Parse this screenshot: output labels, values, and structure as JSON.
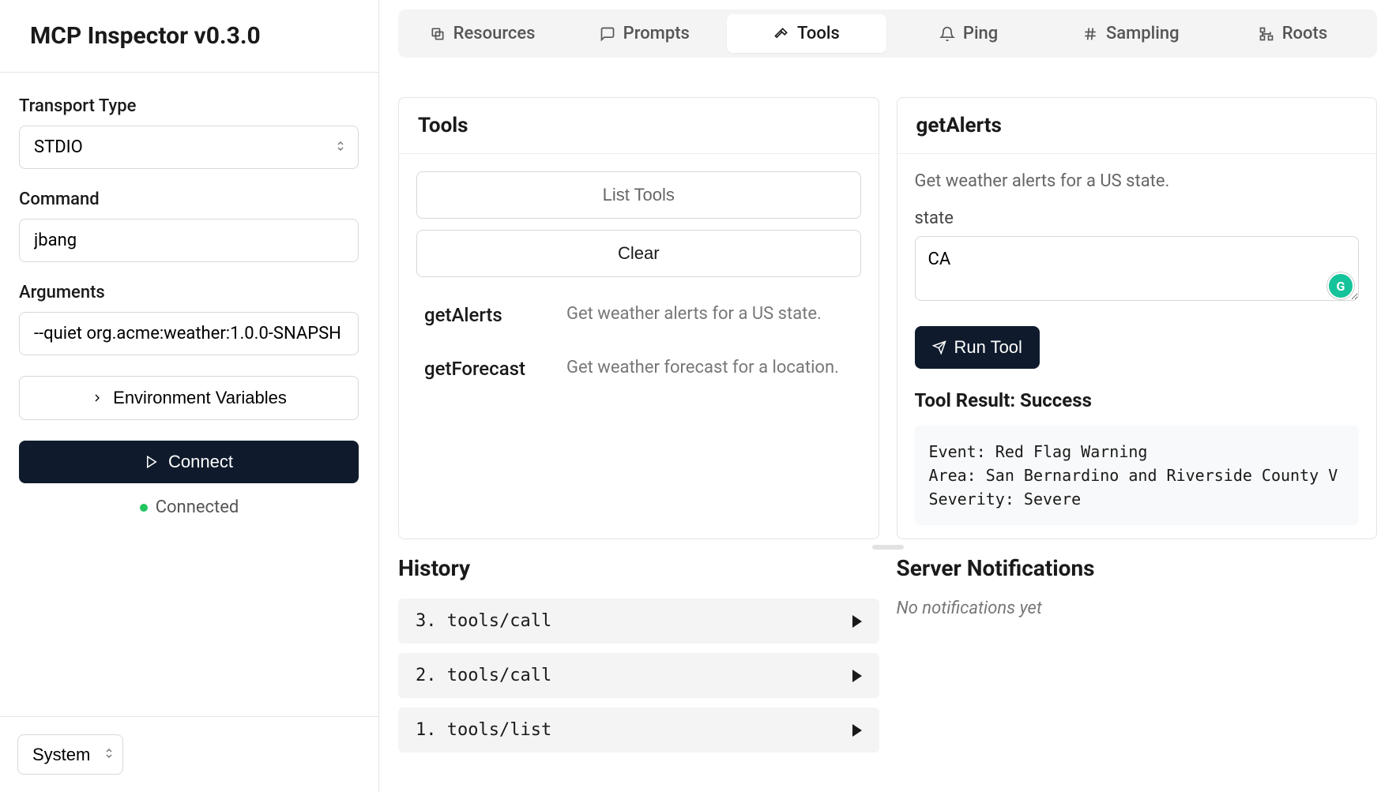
{
  "header": {
    "title": "MCP Inspector v0.3.0"
  },
  "sidebar": {
    "transport_label": "Transport Type",
    "transport_value": "STDIO",
    "command_label": "Command",
    "command_value": "jbang",
    "arguments_label": "Arguments",
    "arguments_value": "--quiet org.acme:weather:1.0.0-SNAPSH",
    "env_label": "Environment Variables",
    "connect_label": "Connect",
    "status_label": "Connected",
    "theme_value": "System"
  },
  "tabs": [
    {
      "label": "Resources",
      "icon": "copy"
    },
    {
      "label": "Prompts",
      "icon": "message"
    },
    {
      "label": "Tools",
      "icon": "hammer",
      "active": true
    },
    {
      "label": "Ping",
      "icon": "bell"
    },
    {
      "label": "Sampling",
      "icon": "hash"
    },
    {
      "label": "Roots",
      "icon": "tree"
    }
  ],
  "tools_panel": {
    "title": "Tools",
    "list_label": "List Tools",
    "clear_label": "Clear",
    "items": [
      {
        "name": "getAlerts",
        "desc": "Get weather alerts for a US state."
      },
      {
        "name": "getForecast",
        "desc": "Get weather forecast for a location."
      }
    ]
  },
  "detail_panel": {
    "title": "getAlerts",
    "description": "Get weather alerts for a US state.",
    "param_label": "state",
    "param_value": "CA",
    "run_label": "Run Tool",
    "result_title": "Tool Result: Success",
    "result_body": "Event: Red Flag Warning\nArea: San Bernardino and Riverside County V\nSeverity: Severe"
  },
  "history": {
    "title": "History",
    "items": [
      {
        "label": "3. tools/call"
      },
      {
        "label": "2. tools/call"
      },
      {
        "label": "1. tools/list"
      }
    ]
  },
  "notifications": {
    "title": "Server Notifications",
    "empty": "No notifications yet"
  }
}
